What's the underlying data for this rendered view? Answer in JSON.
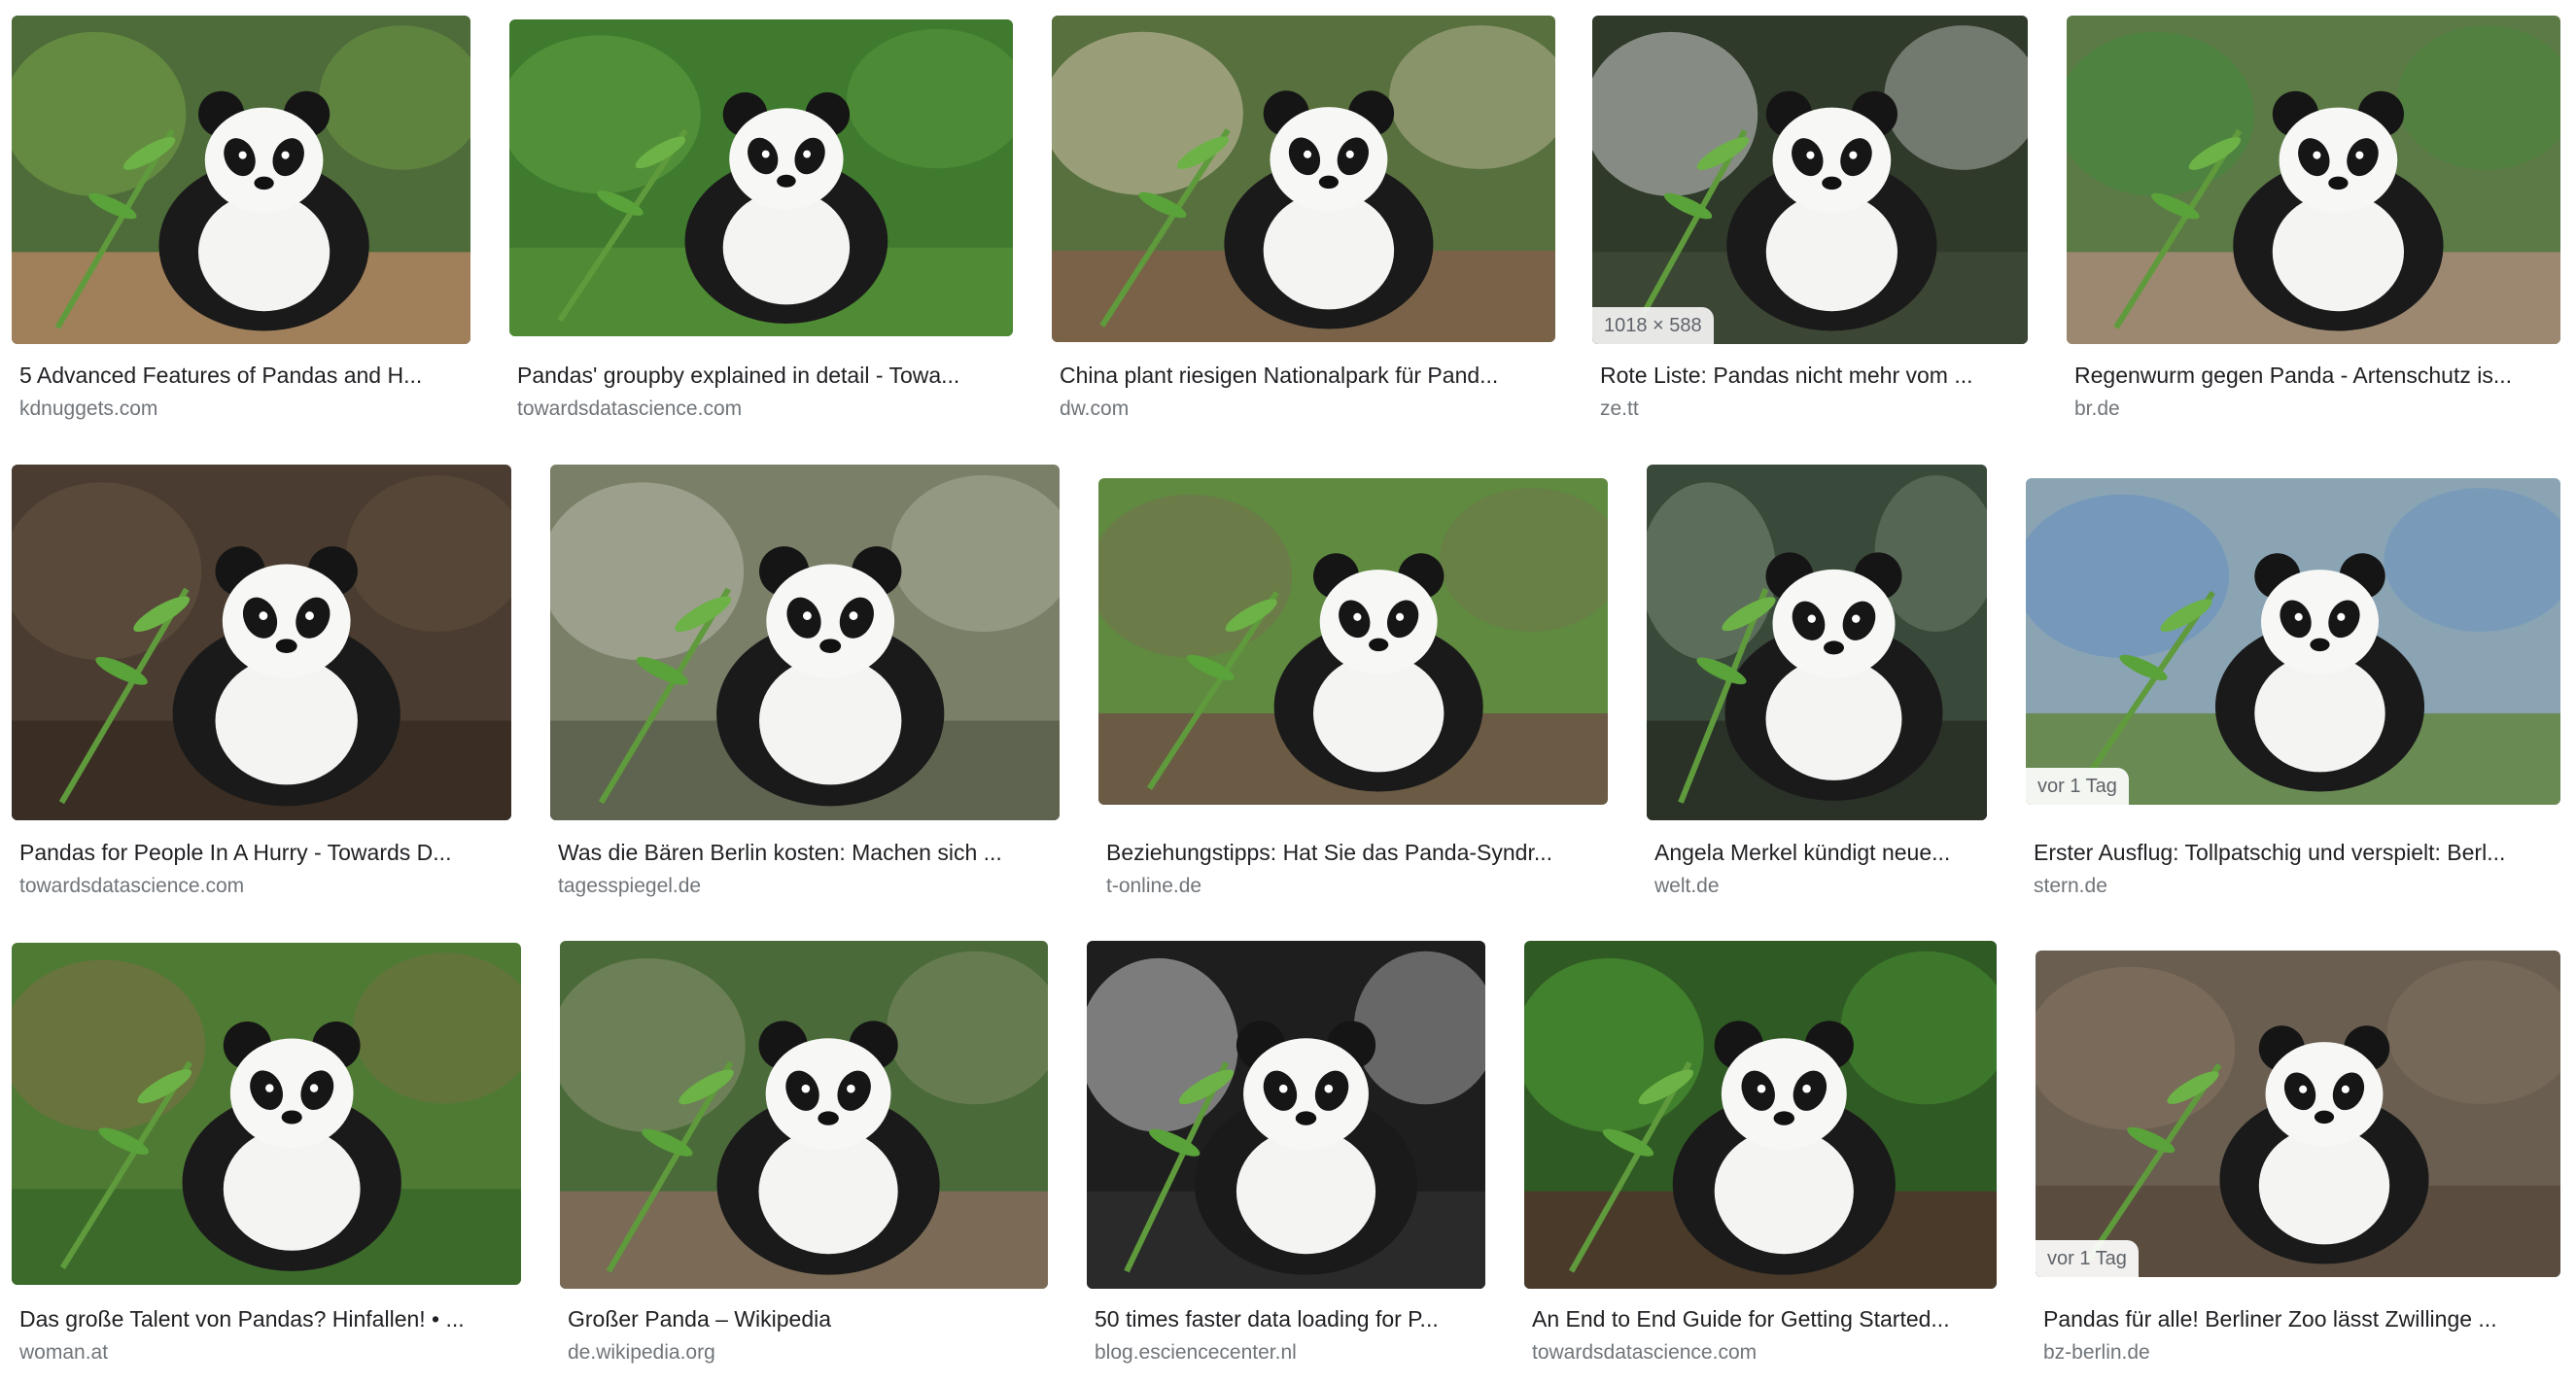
{
  "results": [
    {
      "title": "5 Advanced Features of Pandas and H...",
      "source": "kdnuggets.com",
      "image_icon": "panda-with-bamboo-image",
      "palette": {
        "bg": "#4e6b3a",
        "accent": "#7fb24a",
        "ground": "#a0805a"
      }
    },
    {
      "title": "Pandas' groupby explained in detail - Towa...",
      "source": "towardsdatascience.com",
      "image_icon": "panda-cubs-on-grass-image",
      "palette": {
        "bg": "#3f7a2e",
        "accent": "#68a844",
        "ground": "#4f8a34"
      }
    },
    {
      "title": "China plant riesigen Nationalpark für Pand...",
      "source": "dw.com",
      "image_icon": "panda-lying-on-log-image",
      "palette": {
        "bg": "#58703e",
        "accent": "#e8d8c0",
        "ground": "#7a6248"
      }
    },
    {
      "title": "Rote Liste: Pandas nicht mehr vom ...",
      "source": "ze.tt",
      "image_icon": "panda-waving-image",
      "badge": "1018 × 588",
      "palette": {
        "bg": "#2f3a2a",
        "accent": "#f2f2f2",
        "ground": "#3c4634"
      }
    },
    {
      "title": "Regenwurm gegen Panda - Artenschutz is...",
      "source": "br.de",
      "image_icon": "panda-eating-leaves-image",
      "palette": {
        "bg": "#5c7a46",
        "accent": "#3f8c3a",
        "ground": "#9c8870"
      }
    },
    {
      "title": "Pandas for People In A Hurry - Towards D...",
      "source": "towardsdatascience.com",
      "image_icon": "panda-cubs-cuddling-image",
      "palette": {
        "bg": "#4a3c30",
        "accent": "#6b5846",
        "ground": "#3a2e24"
      }
    },
    {
      "title": "Was die Bären Berlin kosten: Machen sich ...",
      "source": "tagesspiegel.de",
      "image_icon": "panda-with-stick-image",
      "palette": {
        "bg": "#7a8068",
        "accent": "#c4c6b8",
        "ground": "#5e6450"
      }
    },
    {
      "title": "Beziehungstipps: Hat Sie das Panda-Syndr...",
      "source": "t-online.de",
      "image_icon": "two-pandas-on-platform-image",
      "palette": {
        "bg": "#5f8a40",
        "accent": "#7a6a54",
        "ground": "#6b5a44"
      }
    },
    {
      "title": "Angela Merkel kündigt neue...",
      "source": "welt.de",
      "image_icon": "panda-portrait-image",
      "palette": {
        "bg": "#3a4a3a",
        "accent": "#8a9a86",
        "ground": "#2a3228"
      }
    },
    {
      "title": "Erster Ausflug: Tollpatschig und verspielt: Berl...",
      "source": "stern.de",
      "image_icon": "keepers-holding-cubs-image",
      "badge": "vor 1 Tag",
      "palette": {
        "bg": "#8aa4b4",
        "accent": "#5a8ac4",
        "ground": "#6a8a54"
      }
    },
    {
      "title": "Das große Talent von Pandas? Hinfallen! • ...",
      "source": "woman.at",
      "image_icon": "panda-in-tree-image",
      "palette": {
        "bg": "#4f7a34",
        "accent": "#8a6a4a",
        "ground": "#3c6a2a"
      }
    },
    {
      "title": "Großer Panda – Wikipedia",
      "source": "de.wikipedia.org",
      "image_icon": "panda-standing-image",
      "palette": {
        "bg": "#4a6a3a",
        "accent": "#9a9a7a",
        "ground": "#7a6a56"
      }
    },
    {
      "title": "50 times faster data loading for P...",
      "source": "blog.esciencecenter.nl",
      "image_icon": "panda-closeup-image",
      "palette": {
        "bg": "#1e1e1e",
        "accent": "#f0f0f0",
        "ground": "#2a2a2a"
      }
    },
    {
      "title": "An End to End Guide for Getting Started...",
      "source": "towardsdatascience.com",
      "image_icon": "panda-eating-bamboo-image",
      "palette": {
        "bg": "#2f5a24",
        "accent": "#58b038",
        "ground": "#4a3a2a"
      }
    },
    {
      "title": "Pandas für alle! Berliner Zoo lässt Zwillinge ...",
      "source": "bz-berlin.de",
      "image_icon": "twin-pandas-image",
      "badge": "vor 1 Tag",
      "palette": {
        "bg": "#6a5e50",
        "accent": "#8c7a66",
        "ground": "#5a4c3e"
      }
    }
  ]
}
